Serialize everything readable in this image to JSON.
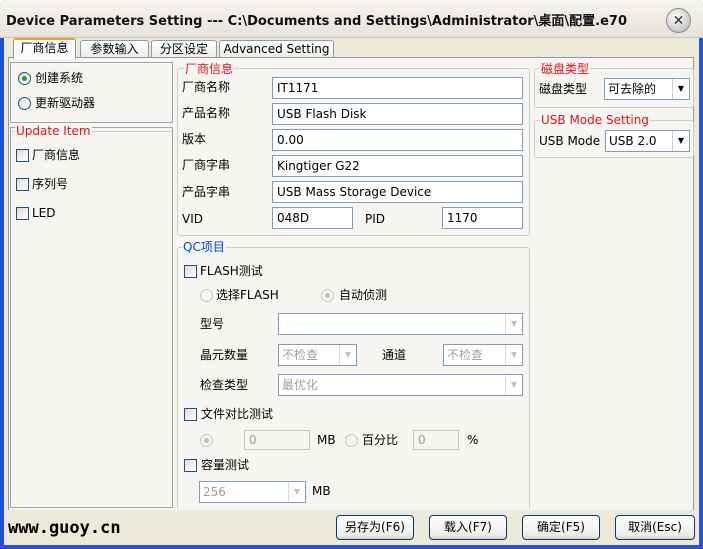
{
  "window": {
    "title": "Device Parameters Setting --- C:\\Documents and Settings\\Administrator\\桌面\\配置.e70",
    "close_glyph": "✕"
  },
  "tabs": [
    "厂商信息",
    "参数输入",
    "分区设定",
    "Advanced Setting"
  ],
  "mode": {
    "options": [
      "创建系统",
      "更新驱动器"
    ],
    "selected": "创建系统"
  },
  "update_item": {
    "title": "Update Item",
    "items": [
      "厂商信息",
      "序列号",
      "LED"
    ]
  },
  "vendor": {
    "title": "厂商信息",
    "fields": [
      {
        "label": "厂商名称",
        "value": "IT1171"
      },
      {
        "label": "产品名称",
        "value": "USB Flash Disk"
      },
      {
        "label": "版本",
        "value": "0.00"
      },
      {
        "label": "厂商字串",
        "value": "Kingtiger G22"
      },
      {
        "label": "产品字串",
        "value": "USB Mass Storage Device"
      }
    ],
    "vid_label": "VID",
    "vid": "048D",
    "pid_label": "PID",
    "pid": "1170"
  },
  "qc": {
    "title": "QC项目",
    "flash_test": "FLASH测试",
    "select_flash": "选择FLASH",
    "auto_detect": "自动侦测",
    "model_label": "型号",
    "model_value": "",
    "die_count_label": "晶元数量",
    "die_count_value": "不检查",
    "channel_label": "通道",
    "channel_value": "不检查",
    "check_type_label": "检查类型",
    "check_type_value": "最优化",
    "file_compare": "文件对比测试",
    "file_mb_value": "0",
    "mb_unit": "MB",
    "percent_label": "百分比",
    "percent_value": "0",
    "percent_unit": "%",
    "capacity_test": "容量测试",
    "capacity_value": "256",
    "capacity_unit": "MB"
  },
  "disk_type": {
    "title": "磁盘类型",
    "label": "磁盘类型",
    "value": "可去除的"
  },
  "usb_mode": {
    "title": "USB Mode Setting",
    "label": "USB Mode :",
    "value": "USB 2.0"
  },
  "buttons": {
    "save_as": "另存为(F6)",
    "load": "载入(F7)",
    "ok": "确定(F5)",
    "cancel": "取消(Esc)"
  },
  "watermark": "www.guoy.cn"
}
